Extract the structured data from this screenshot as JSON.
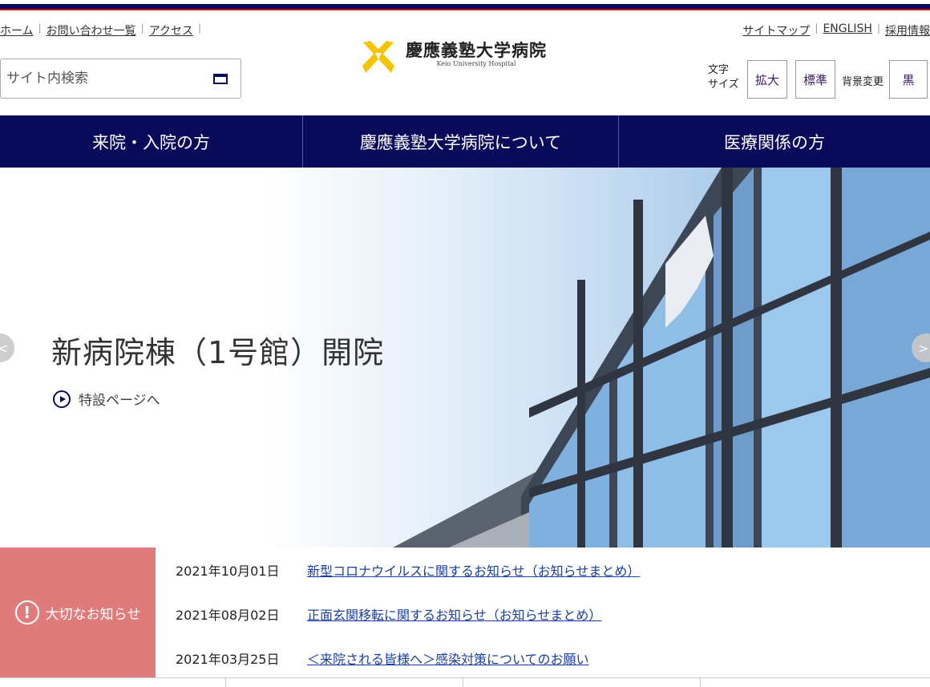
{
  "utility_left": [
    "ホーム",
    "お問い合わせ一覧",
    "アクセス"
  ],
  "utility_right": [
    "サイトマップ",
    "ENGLISH",
    "採用情報"
  ],
  "search": {
    "placeholder": "サイト内検索"
  },
  "logo": {
    "ja": "慶應義塾大学病院",
    "en": "Keio University Hospital"
  },
  "font_size": {
    "label_line1": "文字",
    "label_line2": "サイズ",
    "enlarge": "拡大",
    "standard": "標準"
  },
  "background": {
    "label": "背景変更",
    "black": "黒"
  },
  "global_nav": [
    "来院・入院の方",
    "慶應義塾大学病院について",
    "医療関係の方"
  ],
  "hero": {
    "title": "新病院棟（1号館）開院",
    "link": "特設ページへ",
    "prev": "<",
    "next": ">"
  },
  "notice": {
    "heading": "大切なお知らせ",
    "items": [
      {
        "date": "2021年10月01日",
        "title": "新型コロナウイルスに関するお知らせ（お知らせまとめ）"
      },
      {
        "date": "2021年08月02日",
        "title": "正面玄関移転に関するお知らせ（お知らせまとめ）"
      },
      {
        "date": "2021年03月25日",
        "title": "＜来院される皆様へ＞感染対策についてのお願い"
      }
    ]
  },
  "colors": {
    "navy": "#0a0a5a",
    "notice_bg": "#e07b7b",
    "logo_yellow": "#f5c400"
  }
}
